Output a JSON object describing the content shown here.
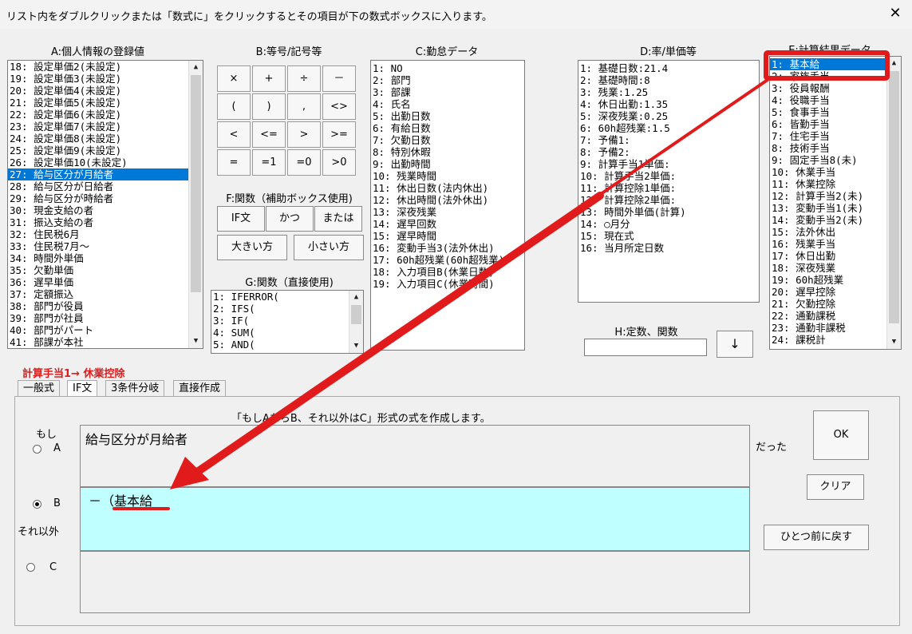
{
  "window": {
    "title": "リスト内をダブルクリックまたは「数式に」をクリックするとその項目が下の数式ボックスに入ります。"
  },
  "headers": {
    "a": "A:個人情報の登録値",
    "b": "B:等号/記号等",
    "c": "C:勤怠データ",
    "d": "D:率/単価等",
    "e": "E:計算結果データ",
    "f": "F:関数（補助ボックス使用)",
    "g": "G:関数（直接使用)",
    "h": "H:定数、関数"
  },
  "listA": [
    "18: 設定単価2(未設定)",
    "19: 設定単価3(未設定)",
    "20: 設定単価4(未設定)",
    "21: 設定単価5(未設定)",
    "22: 設定単価6(未設定)",
    "23: 設定単価7(未設定)",
    "24: 設定単価8(未設定)",
    "25: 設定単価9(未設定)",
    "26: 設定単価10(未設定)",
    "27: 給与区分が月給者",
    "28: 給与区分が日給者",
    "29: 給与区分が時給者",
    "30: 現金支給の者",
    "31: 振込支給の者",
    "32: 住民税6月",
    "33: 住民税7月～",
    "34: 時間外単価",
    "35: 欠勤単価",
    "36: 遅早単価",
    "37: 定額振込",
    "38: 部門が役員",
    "39: 部門が社員",
    "40: 部門がパート",
    "41: 部課が本社"
  ],
  "listC": [
    " 1: NO",
    " 2: 部門",
    " 3: 部課",
    " 4: 氏名",
    " 5: 出勤日数",
    " 6: 有給日数",
    " 7: 欠勤日数",
    " 8: 特別休暇",
    " 9: 出勤時間",
    "10: 残業時間",
    "11: 休出日数(法内休出)",
    "12: 休出時間(法外休出)",
    "13: 深夜残業",
    "14: 遅早回数",
    "15: 遅早時間",
    "16: 変動手当3(法外休出)",
    "17: 60h超残業(60h超残業)",
    "18: 入力項目B(休業日数)",
    "19: 入力項目C(休業時間)"
  ],
  "listD": [
    " 1: 基礎日数:21.4",
    " 2: 基礎時間:8",
    " 3: 残業:1.25",
    " 4: 休日出勤:1.35",
    " 5: 深夜残業:0.25",
    " 6: 60h超残業:1.5",
    " 7: 予備1:",
    " 8: 予備2:",
    " 9: 計算手当1単価:",
    "10: 計算手当2単価:",
    "11: 計算控除1単価:",
    "12: 計算控除2単価:",
    "13: 時間外単価(計算)",
    "14: ○月分",
    "15: 現在式",
    "16: 当月所定日数"
  ],
  "listE": [
    " 1: 基本給",
    " 2: 家族手当",
    " 3: 役員報酬",
    " 4: 役職手当",
    " 5: 食事手当",
    " 6: 皆勤手当",
    " 7: 住宅手当",
    " 8: 技術手当",
    " 9: 固定手当8(未)",
    "10: 休業手当",
    "11: 休業控除",
    "12: 計算手当2(未)",
    "13: 変動手当1(未)",
    "14: 変動手当2(未)",
    "15: 法外休出",
    "16: 残業手当",
    "17: 休日出勤",
    "18: 深夜残業",
    "19: 60h超残業",
    "20: 遅早控除",
    "21: 欠勤控除",
    "22: 通勤課税",
    "23: 通勤非課税",
    "24: 課税計"
  ],
  "listG": [
    " 1: IFERROR(",
    " 2: IFS(",
    " 3: IF(",
    " 4: SUM(",
    " 5: AND("
  ],
  "opButtons": [
    "×",
    "+",
    "÷",
    "－",
    "(",
    ")",
    ",",
    "<>",
    "<",
    "<=",
    ">",
    ">=",
    "=",
    "=1",
    "=0",
    ">0"
  ],
  "fButtons": {
    "if": "IF文",
    "and": "かつ",
    "or": "または",
    "max": "大きい方",
    "min": "小さい方"
  },
  "h": {
    "value": "",
    "arrow": "↓"
  },
  "formula": {
    "target": "計算手当1→ 休業控除",
    "description": "「もしAならB、それ以外はC」形式の式を作成します。",
    "a_value": "給与区分が月給者",
    "b_value": "－（基本給",
    "c_value": ""
  },
  "tabs": [
    "一般式",
    "IF文",
    "3条件分岐",
    "直接作成"
  ],
  "labels": {
    "moshi": "もし",
    "a": "A",
    "b": "B",
    "c": "C",
    "else": "それ以外",
    "datta": "だった"
  },
  "buttons": {
    "ok": "OK",
    "clear": "クリア",
    "back": "ひとつ前に戻す"
  },
  "colors": {
    "selection": "#0078d7",
    "accent_red": "#e11b1b",
    "b_box": "#c0ffff"
  }
}
